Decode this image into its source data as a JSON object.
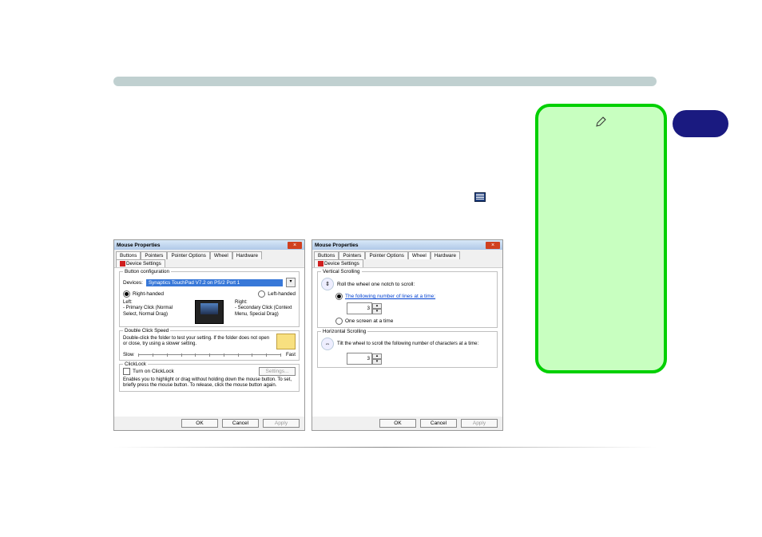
{
  "dialog1": {
    "title": "Mouse Properties",
    "tabs": [
      "Buttons",
      "Pointers",
      "Pointer Options",
      "Wheel",
      "Hardware",
      "Device Settings"
    ],
    "groups": {
      "button_config": {
        "title": "Button configuration",
        "devices_label": "Devices:",
        "device_value": "Synaptics TouchPad V7.2 on PS/2 Port 1",
        "right_handed": "Right-handed",
        "left_handed": "Left-handed",
        "left_label": "Left:",
        "left_desc": "- Primary Click (Normal Select, Normal Drag)",
        "right_label": "Right:",
        "right_desc": "- Secondary Click (Context Menu, Special Drag)"
      },
      "doubleclick": {
        "title": "Double Click Speed",
        "desc": "Double-click the folder to test your setting. If the folder does not open or close, try using a slower setting.",
        "slow": "Slow",
        "fast": "Fast"
      },
      "clicklock": {
        "title": "ClickLock",
        "turn_on": "Turn on ClickLock",
        "settings": "Settings...",
        "desc": "Enables you to highlight or drag without holding down the mouse button. To set, briefly press the mouse button. To release, click the mouse button again."
      }
    },
    "buttons": {
      "ok": "OK",
      "cancel": "Cancel",
      "apply": "Apply"
    }
  },
  "dialog2": {
    "title": "Mouse Properties",
    "tabs": [
      "Buttons",
      "Pointers",
      "Pointer Options",
      "Wheel",
      "Hardware",
      "Device Settings"
    ],
    "groups": {
      "vertical": {
        "title": "Vertical Scrolling",
        "roll": "Roll the wheel one notch to scroll:",
        "opt_lines": "The following number of lines at a time:",
        "lines_value": "3",
        "opt_screen": "One screen at a time"
      },
      "horizontal": {
        "title": "Horizontal Scrolling",
        "tilt": "Tilt the wheel to scroll the following number of characters at a time:",
        "chars_value": "3"
      }
    },
    "buttons": {
      "ok": "OK",
      "cancel": "Cancel",
      "apply": "Apply"
    }
  }
}
